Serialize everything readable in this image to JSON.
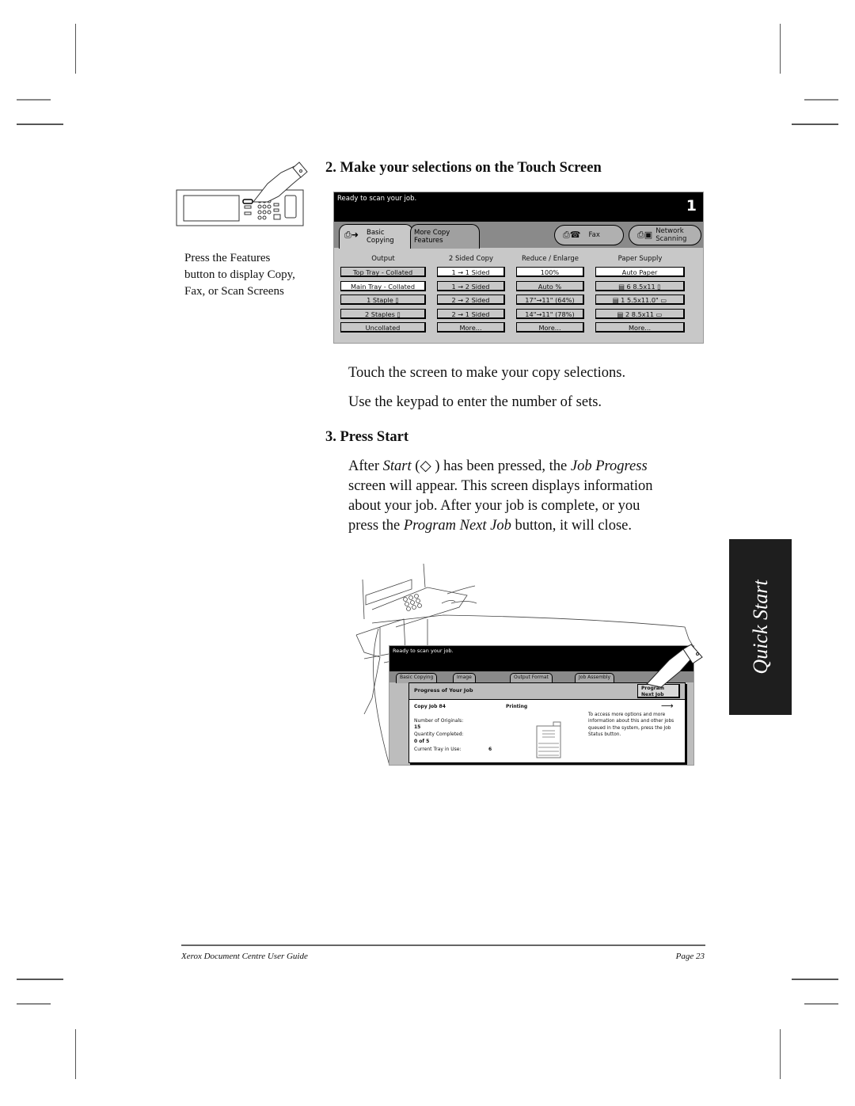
{
  "step2": {
    "heading": "2. Make your selections on the Touch Screen",
    "caption": [
      "Press the Features",
      "button to display Copy,",
      "Fax, or Scan Screens"
    ],
    "body": [
      "Touch the screen to make your copy selections.",
      "Use the keypad to enter the number of sets."
    ]
  },
  "touch_screen": {
    "status_message": "Ready to scan your job.",
    "copy_count": "1",
    "tabs": [
      {
        "label_line1": "Basic",
        "label_line2": "Copying",
        "active": true
      },
      {
        "label_line1": "More Copy",
        "label_line2": "Features",
        "active": false
      }
    ],
    "fax_label": "Fax",
    "network_line1": "Network",
    "network_line2": "Scanning",
    "columns": [
      {
        "header": "Output",
        "options": [
          {
            "label": "Top Tray - Collated",
            "selected": false
          },
          {
            "label": "Main Tray - Collated",
            "selected": true
          },
          {
            "label": "1 Staple ▯",
            "selected": false
          },
          {
            "label": "2 Staples ▯",
            "selected": false
          },
          {
            "label": "Uncollated",
            "selected": false
          }
        ]
      },
      {
        "header": "2 Sided Copy",
        "options": [
          {
            "label": "1 → 1 Sided",
            "selected": true
          },
          {
            "label": "1 → 2 Sided",
            "selected": false
          },
          {
            "label": "2 → 2 Sided",
            "selected": false
          },
          {
            "label": "2 → 1 Sided",
            "selected": false
          },
          {
            "label": "More...",
            "selected": false
          }
        ]
      },
      {
        "header": "Reduce / Enlarge",
        "options": [
          {
            "label": "100%",
            "selected": true
          },
          {
            "label": "Auto %",
            "selected": false
          },
          {
            "label": "17\"→11\" (64%)",
            "selected": false
          },
          {
            "label": "14\"→11\" (78%)",
            "selected": false
          },
          {
            "label": "More...",
            "selected": false
          }
        ]
      },
      {
        "header": "Paper Supply",
        "options": [
          {
            "label": "Auto Paper",
            "selected": true
          },
          {
            "label": "▤ 6  8.5x11 ▯",
            "selected": false
          },
          {
            "label": "▤ 1  5.5x11.0\" ▭",
            "selected": false
          },
          {
            "label": "▤ 2  8.5x11 ▭",
            "selected": false
          },
          {
            "label": "More...",
            "selected": false
          }
        ]
      }
    ]
  },
  "step3": {
    "heading": "3. Press Start",
    "lines": [
      {
        "a": "After ",
        "i1": "Start",
        "b": " (",
        "icon": "◇",
        "c": " ) has been pressed, the ",
        "i2": "Job Progress"
      },
      {
        "a": "screen will appear. This screen displays information"
      },
      {
        "a": "about your job. After your job is complete, or you"
      },
      {
        "a": "press the ",
        "i1": "Program Next Job",
        "b": " button, it will close."
      }
    ]
  },
  "job_progress_screen": {
    "status_message": "Ready to scan your job.",
    "tabs": [
      "Basic Copying",
      "Image",
      "Output Format",
      "Job Assembly"
    ],
    "title": "Progress of Your Job",
    "program_next_job_line1": "Program",
    "program_next_job_line2": "Next Job",
    "job_name": "Copy Job 84",
    "job_state": "Printing",
    "originals_label": "Number of Originals:",
    "originals_value": "15",
    "quantity_label": "Quantity Completed:",
    "quantity_value": "0 of 5",
    "tray_label": "Current Tray in Use:",
    "tray_value": "6",
    "info_text": "To access more options and more information about this and other jobs queued in the system, press the Job Status button."
  },
  "side_tab": "Quick Start",
  "footer": {
    "title": "Xerox Document Centre User Guide",
    "page": "Page 23"
  }
}
